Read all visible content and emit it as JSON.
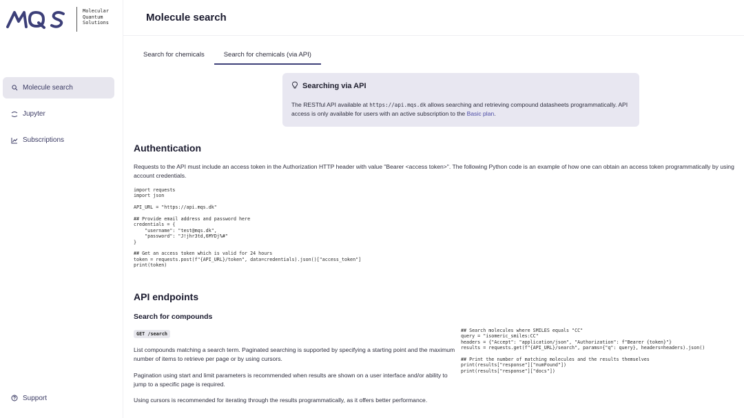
{
  "logo": {
    "mark": "MQS",
    "lines": [
      "Molecular",
      "Quantum",
      "Solutions"
    ]
  },
  "sidebar": {
    "items": [
      {
        "label": "Molecule search",
        "icon": "search-icon",
        "active": true
      },
      {
        "label": "Jupyter",
        "icon": "jupyter-icon",
        "active": false
      },
      {
        "label": "Subscriptions",
        "icon": "chart-icon",
        "active": false
      }
    ],
    "support": {
      "label": "Support",
      "icon": "help-circle-icon"
    }
  },
  "header": {
    "title": "Molecule search"
  },
  "tabs": [
    {
      "label": "Search for chemicals",
      "active": false
    },
    {
      "label": "Search for chemicals (via API)",
      "active": true
    }
  ],
  "callout": {
    "icon": "lightbulb-icon",
    "title": "Searching via API",
    "text_before": "The RESTful API available at ",
    "url": "https://api.mqs.dk",
    "text_after": " allows searching and retrieving compound datasheets programmatically. API access is only available for users with an active subscription to the ",
    "link_label": "Basic plan",
    "text_end": "."
  },
  "auth": {
    "heading": "Authentication",
    "paragraph": "Requests to the API must include an access token in the Authorization HTTP header with value \"Bearer <access token>\". The following Python code is an example of how one can obtain an access token programmatically by using account credentials.",
    "code": "import requests\nimport json\n\nAPI_URL = \"https://api.mqs.dk\"\n\n## Provide email address and password here\ncredentials = {\n    \"username\": \"test@mqs.dk\",\n    \"password\": \"J!jhr3td,6MYDj%#\"\n}\n\n## Get an access token which is valid for 24 hours\ntoken = requests.post(f\"{API_URL}/token\", data=credentials).json()[\"access_token\"]\nprint(token)"
  },
  "endpoints": {
    "heading": "API endpoints",
    "search": {
      "heading": "Search for compounds",
      "badge": "GET /search",
      "p1": "List compounds matching a search term. Paginated searching is supported by specifying a starting point and the maximum number of items to retrieve per page or by using cursors.",
      "p2": "Pagination using start and limit parameters is recommended when results are shown on a user interface and/or ability to jump to a specific page is required.",
      "p3": "Using cursors is recommended for iterating through the results programmatically, as it offers better performance.",
      "code": "## Search molecules where SMILES equals \"CC\"\nquery = \"isomeric_smiles:CC\"\nheaders = {\"Accept\": \"application/json\", \"Authorization\": f\"Bearer {token}\"}\nresults = requests.get(f\"{API_URL}/search\", params={\"q\": query}, headers=headers).json()\n\n## Print the number of matching molecules and the results themselves\nprint(results[\"response\"][\"numFound\"])\nprint(results[\"response\"][\"docs\"])"
    }
  },
  "colors": {
    "accent": "#3c3f78",
    "callout_bg": "#e8e7f1",
    "nav_active_bg": "#e7e6ee",
    "link": "#4b4ba5"
  }
}
